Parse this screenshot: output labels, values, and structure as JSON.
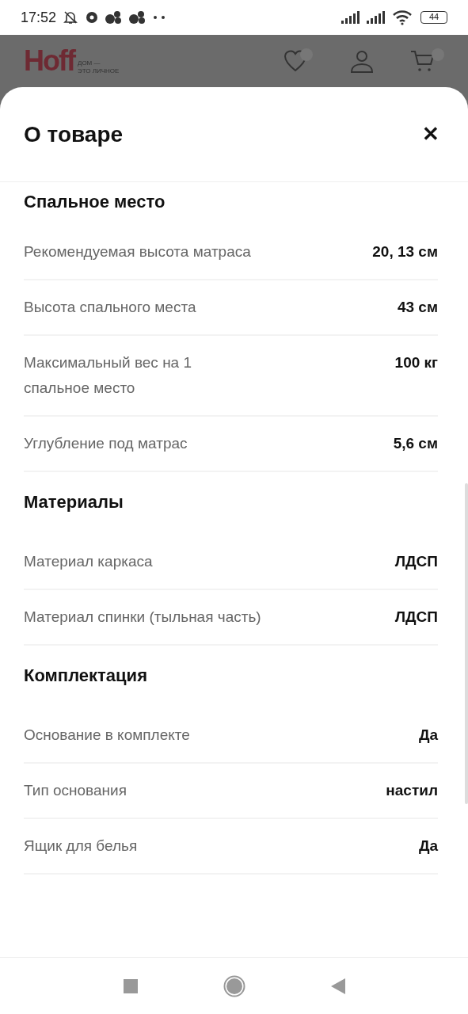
{
  "status_bar": {
    "time": "17:52",
    "battery": "44"
  },
  "site_header": {
    "logo": "Hoff",
    "tagline_1": "ДОМ —",
    "tagline_2": "ЭТО ЛИЧНОЕ"
  },
  "sheet": {
    "title": "О товаре",
    "close": "✕"
  },
  "sections": [
    {
      "title": "Спальное место",
      "rows": [
        {
          "label": "Рекомендуемая высота матраса",
          "value": "20, 13 см"
        },
        {
          "label": "Высота спального места",
          "value": "43 см"
        },
        {
          "label": "Максимальный вес на 1 спальное место",
          "value": "100 кг"
        },
        {
          "label": "Углубление под матрас",
          "value": "5,6 см"
        }
      ]
    },
    {
      "title": "Материалы",
      "rows": [
        {
          "label": "Материал каркаса",
          "value": "ЛДСП"
        },
        {
          "label": "Материал спинки (тыльная часть)",
          "value": "ЛДСП"
        }
      ]
    },
    {
      "title": "Комплектация",
      "rows": [
        {
          "label": "Основание в комплекте",
          "value": "Да"
        },
        {
          "label": "Тип основания",
          "value": "настил"
        },
        {
          "label": "Ящик для белья",
          "value": "Да"
        }
      ]
    }
  ]
}
